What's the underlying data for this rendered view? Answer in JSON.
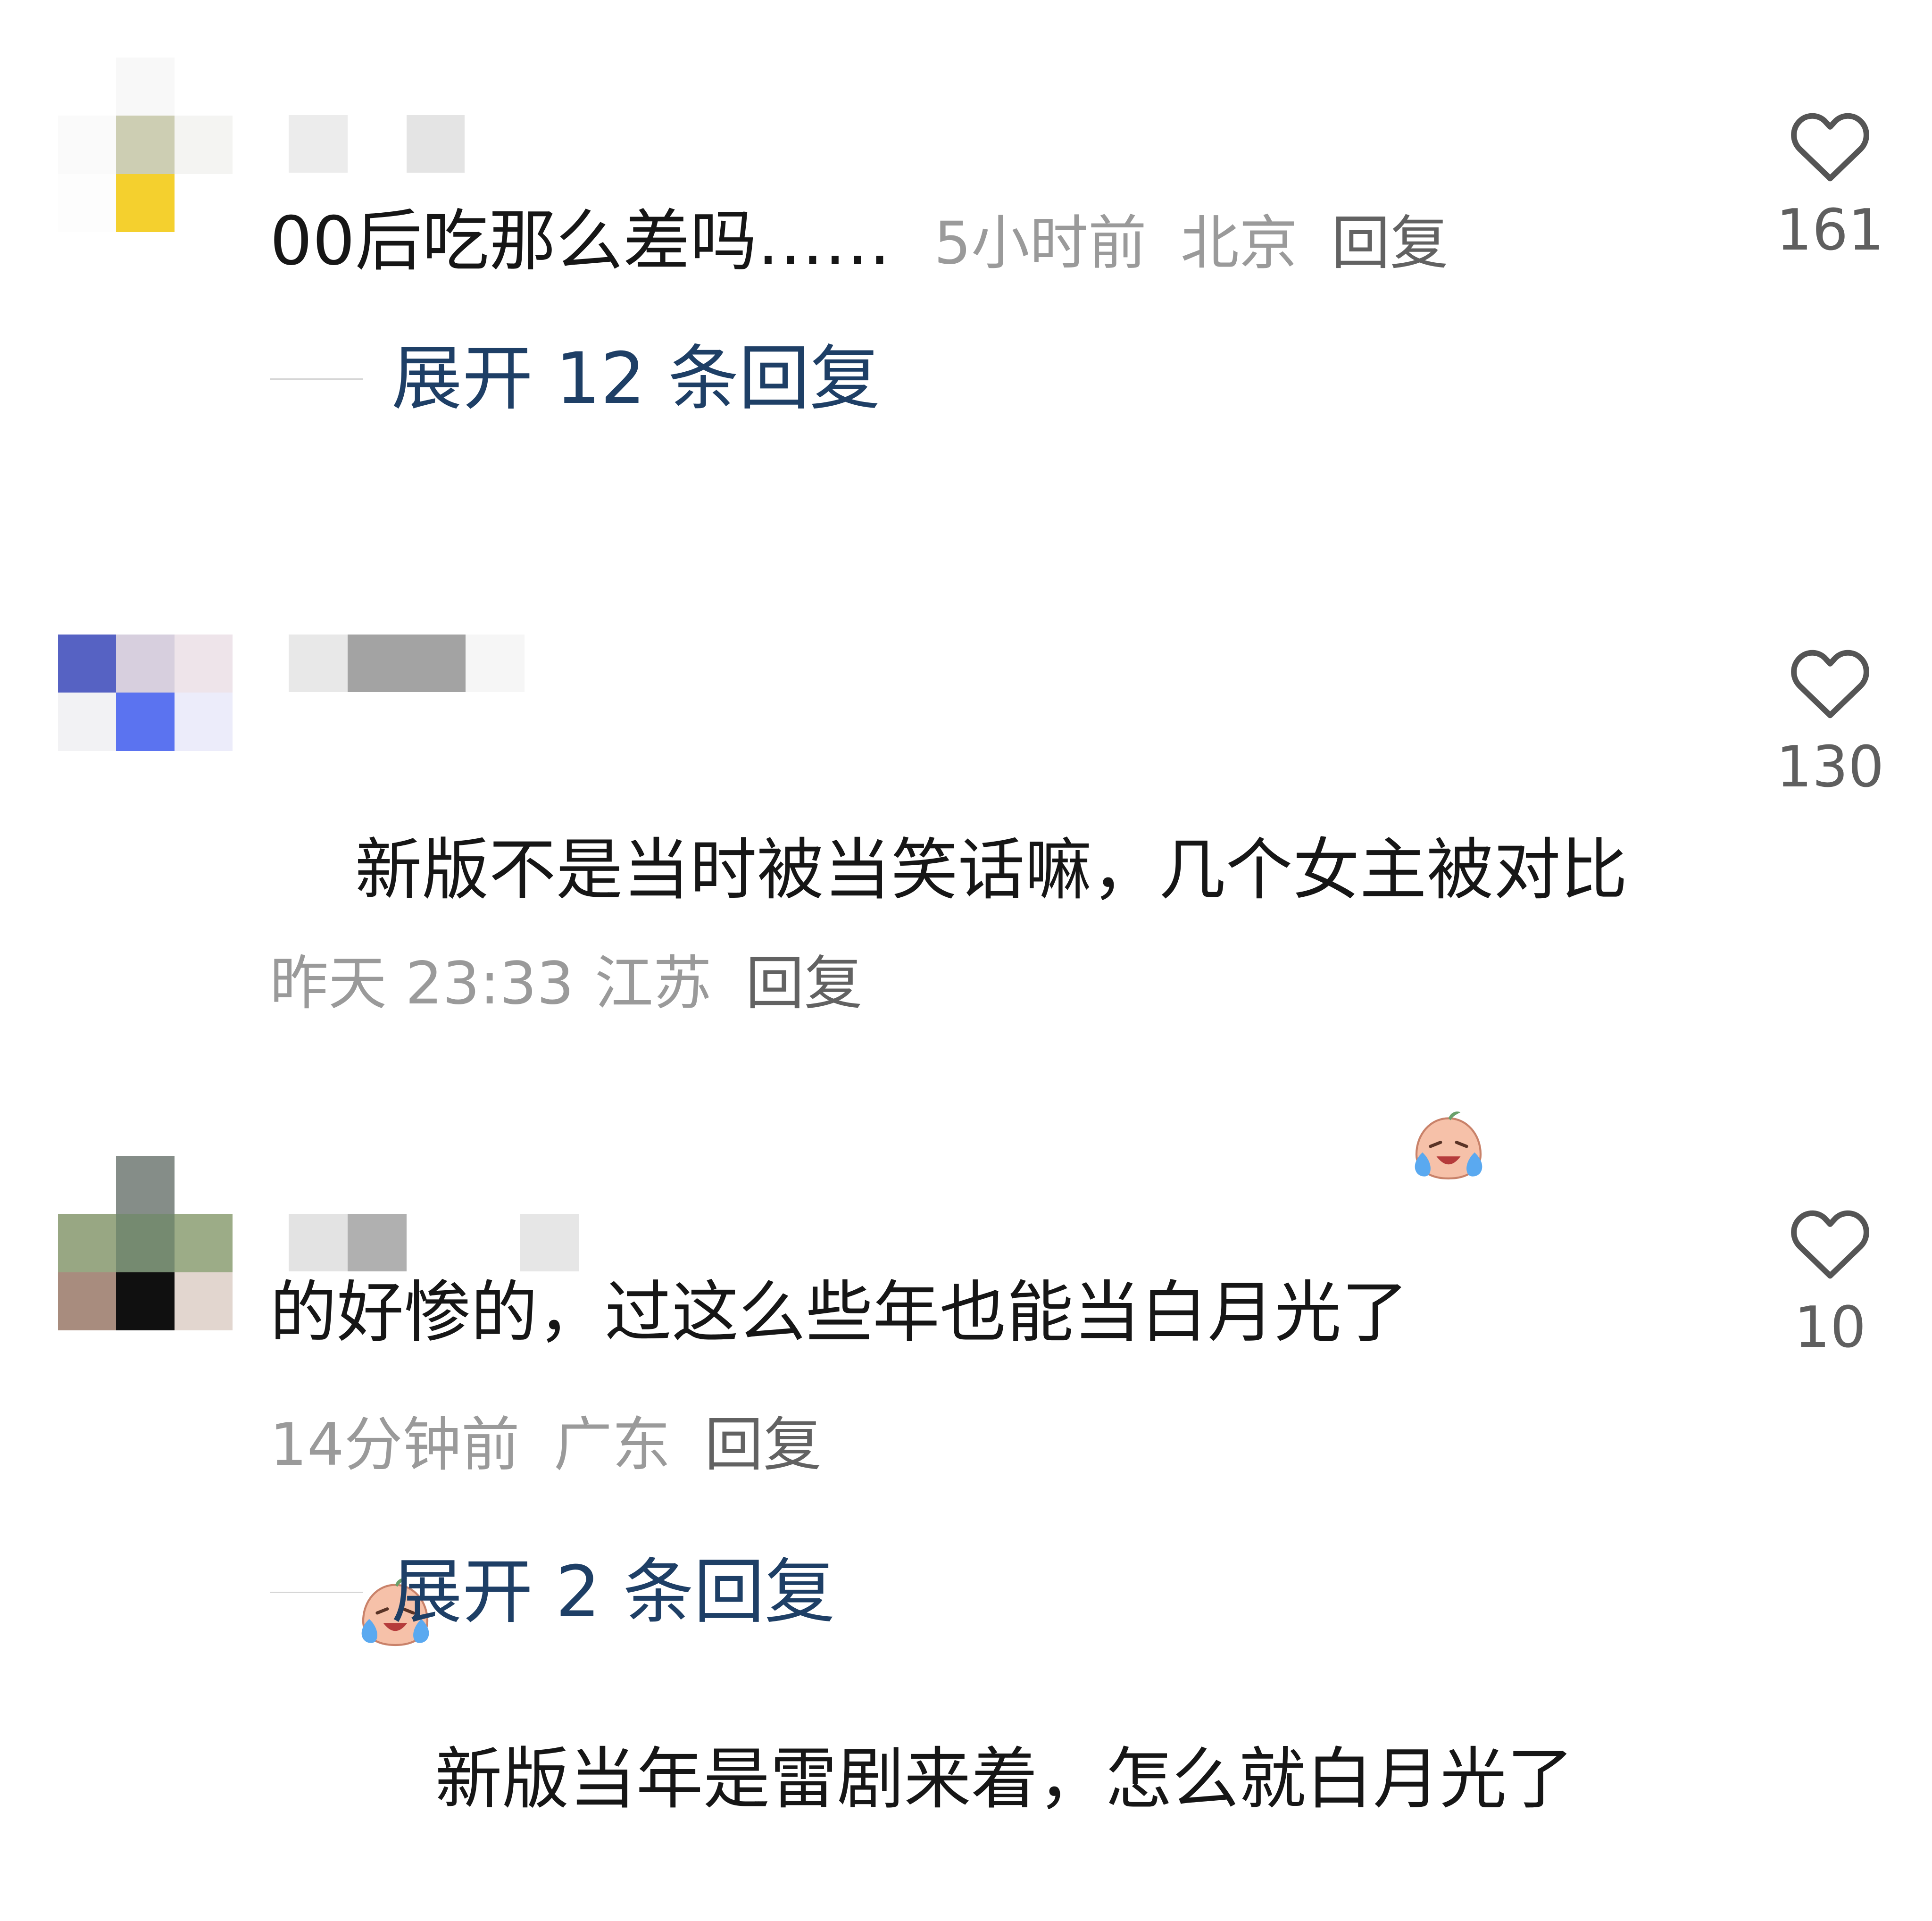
{
  "comments": [
    {
      "avatar_colors": [
        "#ffffff",
        "#f8f8f8",
        "#ffffff",
        "#fafafa",
        "#cdceb3",
        "#f4f4f2",
        "#fdfdfd",
        "#f4d02e",
        "#ffffff"
      ],
      "text": "00后吃那么差吗……",
      "time": "5小时前",
      "location": "北京",
      "reply_label": "回复",
      "likes": "161",
      "expand_label": "展开 12 条回复"
    },
    {
      "avatar_colors": [
        "#5662c3",
        "#d7cfde",
        "#eee4ea",
        "#f2f2f4",
        "#5b73f0",
        "#ececfa",
        "#ffffff",
        "#ffffff",
        "#ffffff"
      ],
      "text_before_emoji": "新版不是当时被当笑话嘛，几个女主被对比的好惨的，过这么些年也能当白月光了",
      "emoji_name": "crying-laughing-face-icon",
      "time": "昨天 23:33",
      "location": "江苏",
      "reply_label": "回复",
      "likes": "130"
    },
    {
      "avatar_colors": [
        "#ffffff",
        "#858d88",
        "#ffffff",
        "#98a783",
        "#758a70",
        "#9cac87",
        "#a88c7e",
        "#101010",
        "#e2d6cf"
      ],
      "emoji_name": "crying-laughing-face-icon",
      "text_after_emoji": "新版当年是雷剧来着，怎么就白月光了",
      "time": "14分钟前",
      "location": "广东",
      "reply_label": "回复",
      "likes": "10",
      "expand_label": "展开 2 条回复"
    }
  ],
  "icons": {
    "like": "heart-outline-icon"
  },
  "colors": {
    "text": "#161616",
    "meta": "#9a9a9a",
    "expand_link": "#1e3f66",
    "like_count": "#5f5f5f"
  }
}
